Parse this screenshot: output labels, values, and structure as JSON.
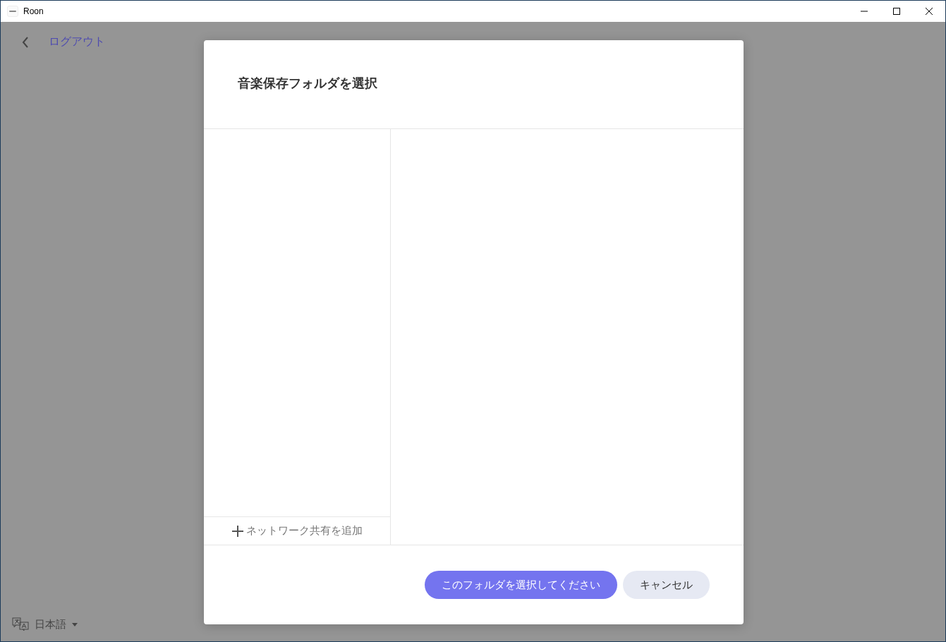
{
  "window": {
    "title": "Roon"
  },
  "background": {
    "back_link": "ログアウト",
    "language": "日本語"
  },
  "dialog": {
    "title": "音楽保存フォルダを選択",
    "add_share": "ネットワーク共有を追加",
    "buttons": [
      {
        "label": "このフォルダを選択してください",
        "kind": "primary"
      },
      {
        "label": "キャンセル",
        "kind": "secondary"
      }
    ]
  }
}
